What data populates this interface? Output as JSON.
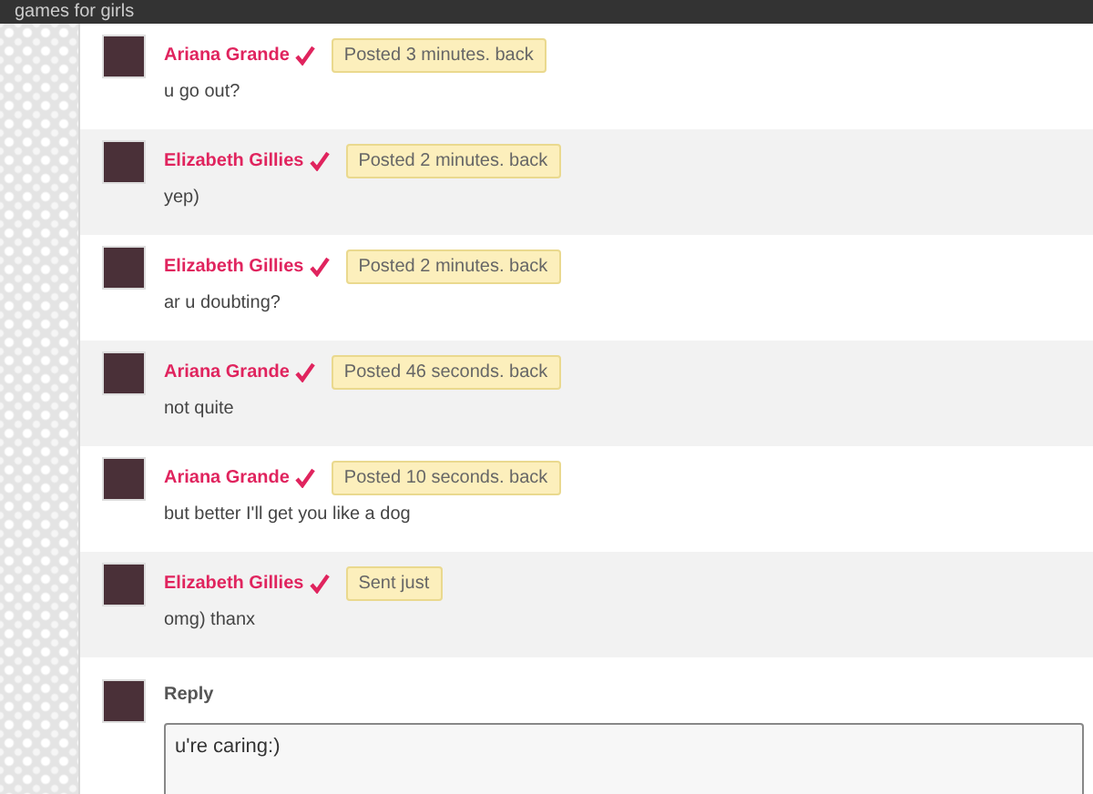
{
  "top_bar": {
    "title": "games for girls"
  },
  "messages": [
    {
      "author": "Ariana Grande",
      "time": "Posted 3 minutes. back",
      "text": "u go out?"
    },
    {
      "author": "Elizabeth Gillies",
      "time": "Posted 2 minutes. back",
      "text": "yep)"
    },
    {
      "author": "Elizabeth Gillies",
      "time": "Posted 2 minutes. back",
      "text": "ar u doubting?"
    },
    {
      "author": "Ariana Grande",
      "time": "Posted 46 seconds. back",
      "text": "not quite"
    },
    {
      "author": "Ariana Grande",
      "time": "Posted 10 seconds. back",
      "text": "but better I'll get you like a dog"
    },
    {
      "author": "Elizabeth Gillies",
      "time": "Sent just",
      "text": "omg) thanx"
    }
  ],
  "reply": {
    "label": "Reply",
    "value": "u're caring:)"
  }
}
